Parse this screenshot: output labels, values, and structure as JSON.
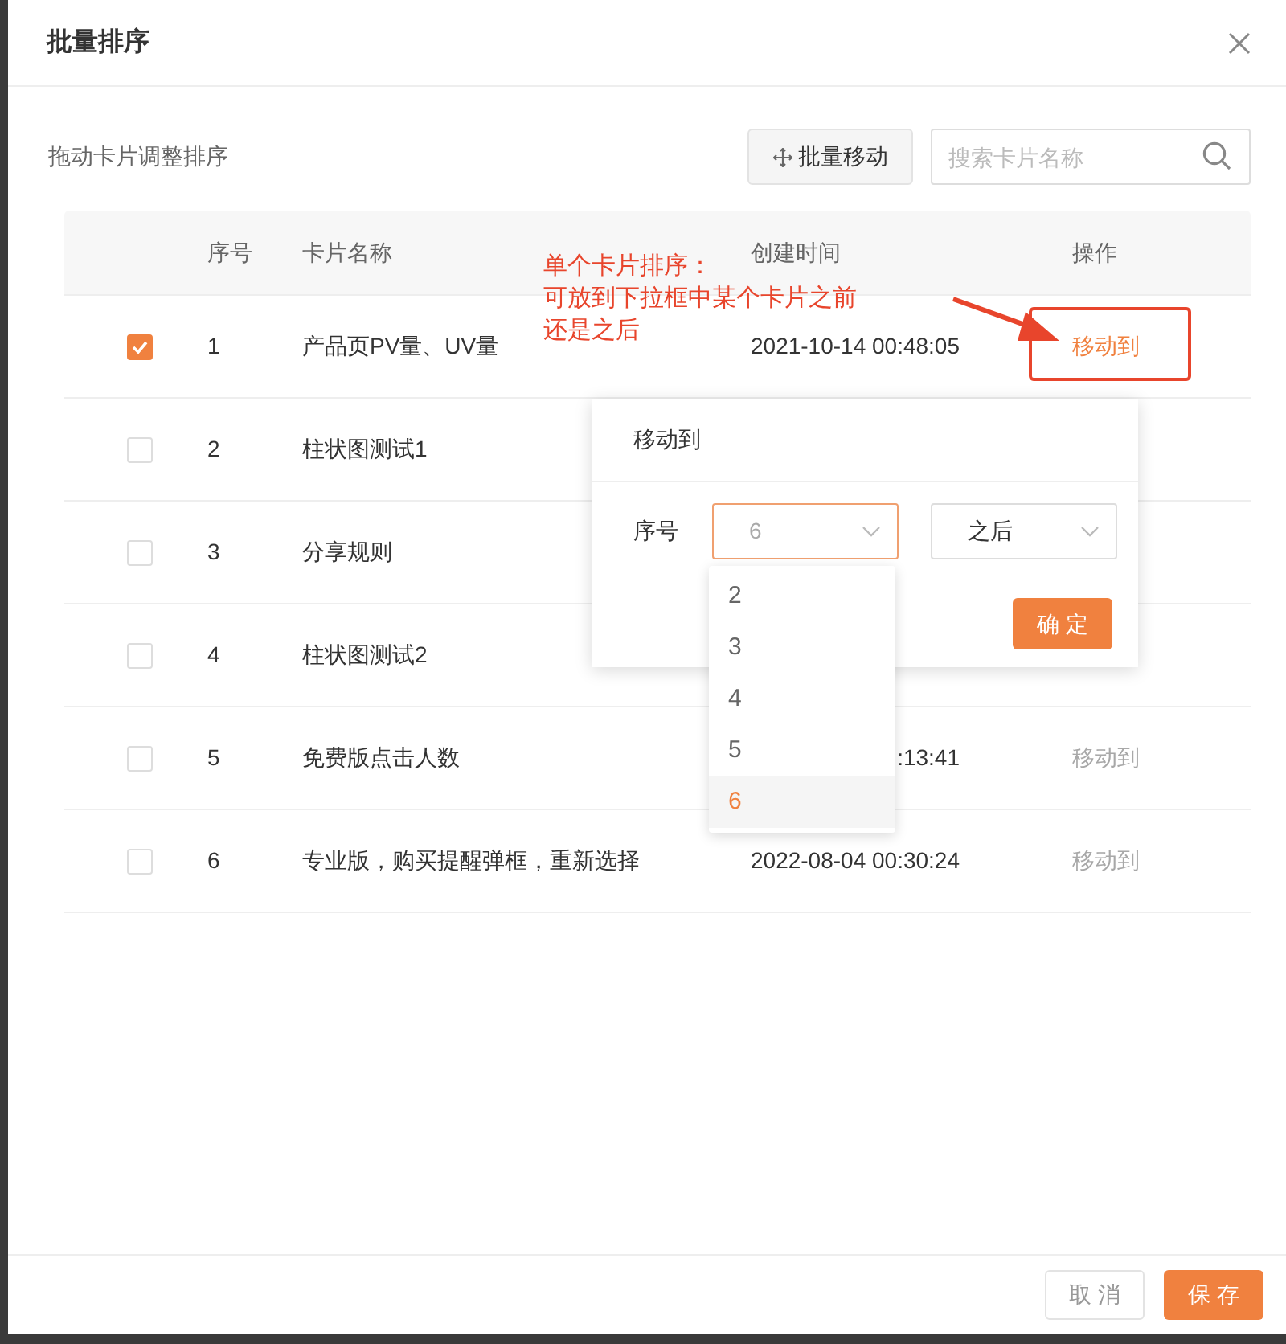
{
  "dialog": {
    "title": "批量排序"
  },
  "toolbar": {
    "hint": "拖动卡片调整排序",
    "batch_move_button": "批量移动",
    "search": {
      "placeholder": "搜索卡片名称"
    }
  },
  "table": {
    "columns": [
      "序号",
      "卡片名称",
      "创建时间",
      "操作"
    ],
    "rows": [
      {
        "checked": true,
        "index": "1",
        "name": "产品页PV量、UV量",
        "created": "2021-10-14 00:48:05",
        "action": "移动到",
        "action_active": true
      },
      {
        "checked": false,
        "index": "2",
        "name": "柱状图测试1"
      },
      {
        "checked": false,
        "index": "3",
        "name": "分享规则"
      },
      {
        "checked": false,
        "index": "4",
        "name": "柱状图测试2"
      },
      {
        "checked": false,
        "index": "5",
        "name": "免费版点击人数",
        "created": ":13:41",
        "action": "移动到",
        "action_active": false
      },
      {
        "checked": false,
        "index": "6",
        "name": "专业版，购买提醒弹框，重新选择",
        "created": "2022-08-04 00:30:24",
        "action": "移动到",
        "action_active": false
      }
    ]
  },
  "popover": {
    "title": "移动到",
    "label": "序号",
    "index_select": {
      "value": "6"
    },
    "position_select": {
      "value": "之后"
    },
    "confirm": "确 定",
    "options": [
      {
        "label": "2",
        "selected": false
      },
      {
        "label": "3",
        "selected": false
      },
      {
        "label": "4",
        "selected": false
      },
      {
        "label": "5",
        "selected": false
      },
      {
        "label": "6",
        "selected": true
      }
    ]
  },
  "annotation": {
    "lines": [
      "单个卡片排序：",
      "可放到下拉框中某个卡片之前",
      "还是之后"
    ]
  },
  "footer": {
    "buttons": [
      {
        "label": "取 消",
        "kind": "secondary"
      },
      {
        "label": "保 存",
        "kind": "primary"
      }
    ]
  }
}
